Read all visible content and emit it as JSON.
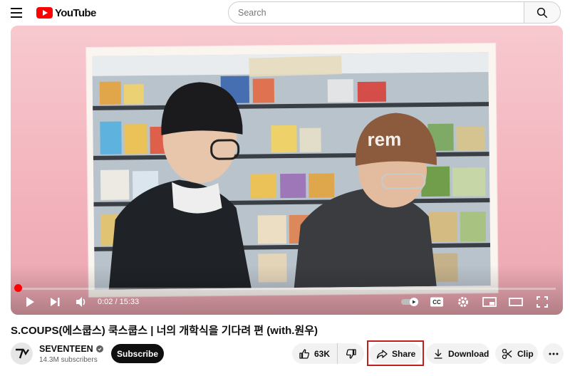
{
  "header": {
    "logo_text": "YouTube",
    "search_placeholder": "Search"
  },
  "player": {
    "time_display": "0:02 / 15:33",
    "progress_fraction": 0.002
  },
  "video": {
    "title": "S.COUPS(에스쿱스) 쿡스쿱스 | 너의 개학식을 기다려 편 (with.원우)"
  },
  "channel": {
    "name": "SEVENTEEN",
    "subscribers": "14.3M subscribers",
    "subscribe_label": "Subscribe"
  },
  "actions": {
    "like_count": "63K",
    "share_label": "Share",
    "download_label": "Download",
    "clip_label": "Clip"
  },
  "colors": {
    "brand_red": "#ff0000",
    "highlight_outline": "#c41e1e"
  }
}
